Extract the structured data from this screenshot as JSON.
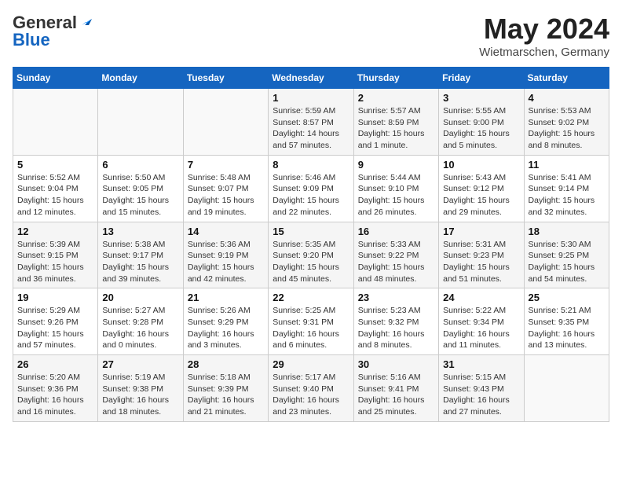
{
  "header": {
    "logo_line1": "General",
    "logo_line2": "Blue",
    "title": "May 2024",
    "subtitle": "Wietmarschen, Germany"
  },
  "calendar": {
    "days_of_week": [
      "Sunday",
      "Monday",
      "Tuesday",
      "Wednesday",
      "Thursday",
      "Friday",
      "Saturday"
    ],
    "weeks": [
      {
        "days": [
          {
            "number": "",
            "info": ""
          },
          {
            "number": "",
            "info": ""
          },
          {
            "number": "",
            "info": ""
          },
          {
            "number": "1",
            "info": "Sunrise: 5:59 AM\nSunset: 8:57 PM\nDaylight: 14 hours\nand 57 minutes."
          },
          {
            "number": "2",
            "info": "Sunrise: 5:57 AM\nSunset: 8:59 PM\nDaylight: 15 hours\nand 1 minute."
          },
          {
            "number": "3",
            "info": "Sunrise: 5:55 AM\nSunset: 9:00 PM\nDaylight: 15 hours\nand 5 minutes."
          },
          {
            "number": "4",
            "info": "Sunrise: 5:53 AM\nSunset: 9:02 PM\nDaylight: 15 hours\nand 8 minutes."
          }
        ]
      },
      {
        "days": [
          {
            "number": "5",
            "info": "Sunrise: 5:52 AM\nSunset: 9:04 PM\nDaylight: 15 hours\nand 12 minutes."
          },
          {
            "number": "6",
            "info": "Sunrise: 5:50 AM\nSunset: 9:05 PM\nDaylight: 15 hours\nand 15 minutes."
          },
          {
            "number": "7",
            "info": "Sunrise: 5:48 AM\nSunset: 9:07 PM\nDaylight: 15 hours\nand 19 minutes."
          },
          {
            "number": "8",
            "info": "Sunrise: 5:46 AM\nSunset: 9:09 PM\nDaylight: 15 hours\nand 22 minutes."
          },
          {
            "number": "9",
            "info": "Sunrise: 5:44 AM\nSunset: 9:10 PM\nDaylight: 15 hours\nand 26 minutes."
          },
          {
            "number": "10",
            "info": "Sunrise: 5:43 AM\nSunset: 9:12 PM\nDaylight: 15 hours\nand 29 minutes."
          },
          {
            "number": "11",
            "info": "Sunrise: 5:41 AM\nSunset: 9:14 PM\nDaylight: 15 hours\nand 32 minutes."
          }
        ]
      },
      {
        "days": [
          {
            "number": "12",
            "info": "Sunrise: 5:39 AM\nSunset: 9:15 PM\nDaylight: 15 hours\nand 36 minutes."
          },
          {
            "number": "13",
            "info": "Sunrise: 5:38 AM\nSunset: 9:17 PM\nDaylight: 15 hours\nand 39 minutes."
          },
          {
            "number": "14",
            "info": "Sunrise: 5:36 AM\nSunset: 9:19 PM\nDaylight: 15 hours\nand 42 minutes."
          },
          {
            "number": "15",
            "info": "Sunrise: 5:35 AM\nSunset: 9:20 PM\nDaylight: 15 hours\nand 45 minutes."
          },
          {
            "number": "16",
            "info": "Sunrise: 5:33 AM\nSunset: 9:22 PM\nDaylight: 15 hours\nand 48 minutes."
          },
          {
            "number": "17",
            "info": "Sunrise: 5:31 AM\nSunset: 9:23 PM\nDaylight: 15 hours\nand 51 minutes."
          },
          {
            "number": "18",
            "info": "Sunrise: 5:30 AM\nSunset: 9:25 PM\nDaylight: 15 hours\nand 54 minutes."
          }
        ]
      },
      {
        "days": [
          {
            "number": "19",
            "info": "Sunrise: 5:29 AM\nSunset: 9:26 PM\nDaylight: 15 hours\nand 57 minutes."
          },
          {
            "number": "20",
            "info": "Sunrise: 5:27 AM\nSunset: 9:28 PM\nDaylight: 16 hours\nand 0 minutes."
          },
          {
            "number": "21",
            "info": "Sunrise: 5:26 AM\nSunset: 9:29 PM\nDaylight: 16 hours\nand 3 minutes."
          },
          {
            "number": "22",
            "info": "Sunrise: 5:25 AM\nSunset: 9:31 PM\nDaylight: 16 hours\nand 6 minutes."
          },
          {
            "number": "23",
            "info": "Sunrise: 5:23 AM\nSunset: 9:32 PM\nDaylight: 16 hours\nand 8 minutes."
          },
          {
            "number": "24",
            "info": "Sunrise: 5:22 AM\nSunset: 9:34 PM\nDaylight: 16 hours\nand 11 minutes."
          },
          {
            "number": "25",
            "info": "Sunrise: 5:21 AM\nSunset: 9:35 PM\nDaylight: 16 hours\nand 13 minutes."
          }
        ]
      },
      {
        "days": [
          {
            "number": "26",
            "info": "Sunrise: 5:20 AM\nSunset: 9:36 PM\nDaylight: 16 hours\nand 16 minutes."
          },
          {
            "number": "27",
            "info": "Sunrise: 5:19 AM\nSunset: 9:38 PM\nDaylight: 16 hours\nand 18 minutes."
          },
          {
            "number": "28",
            "info": "Sunrise: 5:18 AM\nSunset: 9:39 PM\nDaylight: 16 hours\nand 21 minutes."
          },
          {
            "number": "29",
            "info": "Sunrise: 5:17 AM\nSunset: 9:40 PM\nDaylight: 16 hours\nand 23 minutes."
          },
          {
            "number": "30",
            "info": "Sunrise: 5:16 AM\nSunset: 9:41 PM\nDaylight: 16 hours\nand 25 minutes."
          },
          {
            "number": "31",
            "info": "Sunrise: 5:15 AM\nSunset: 9:43 PM\nDaylight: 16 hours\nand 27 minutes."
          },
          {
            "number": "",
            "info": ""
          }
        ]
      }
    ]
  }
}
